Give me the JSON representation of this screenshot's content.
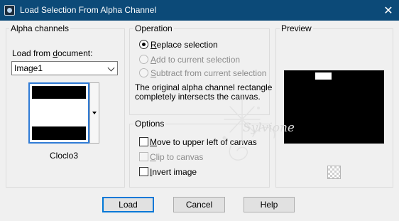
{
  "window": {
    "title": "Load Selection From Alpha Channel",
    "close_glyph": "✕"
  },
  "alpha_channels": {
    "legend": "Alpha channels",
    "load_from_prefix": "Load from ",
    "load_from_underlined": "d",
    "load_from_suffix": "ocument:",
    "document_selected": "Image1",
    "channel_name": "Cloclo3"
  },
  "operation": {
    "legend": "Operation",
    "options": [
      {
        "accel": "R",
        "rest": "eplace selection",
        "checked": true,
        "enabled": true
      },
      {
        "accel": "A",
        "rest": "dd to current selection",
        "checked": false,
        "enabled": false
      },
      {
        "accel": "S",
        "rest": "ubtract from current selection",
        "checked": false,
        "enabled": false
      }
    ],
    "message_line1": "The original alpha channel rectangle",
    "message_line2": "completely intersects the canvas."
  },
  "options": {
    "legend": "Options",
    "items": [
      {
        "accel": "M",
        "rest": "ove to upper left of canvas",
        "checked": false,
        "enabled": true
      },
      {
        "accel": "C",
        "rest": "lip to canvas",
        "checked": false,
        "enabled": false
      },
      {
        "accel": "I",
        "rest": "nvert image",
        "checked": false,
        "enabled": true
      }
    ]
  },
  "preview": {
    "legend": "Preview"
  },
  "buttons": {
    "load": "Load",
    "cancel": "Cancel",
    "help": "Help"
  },
  "watermark": {
    "text": "Sylvione"
  }
}
